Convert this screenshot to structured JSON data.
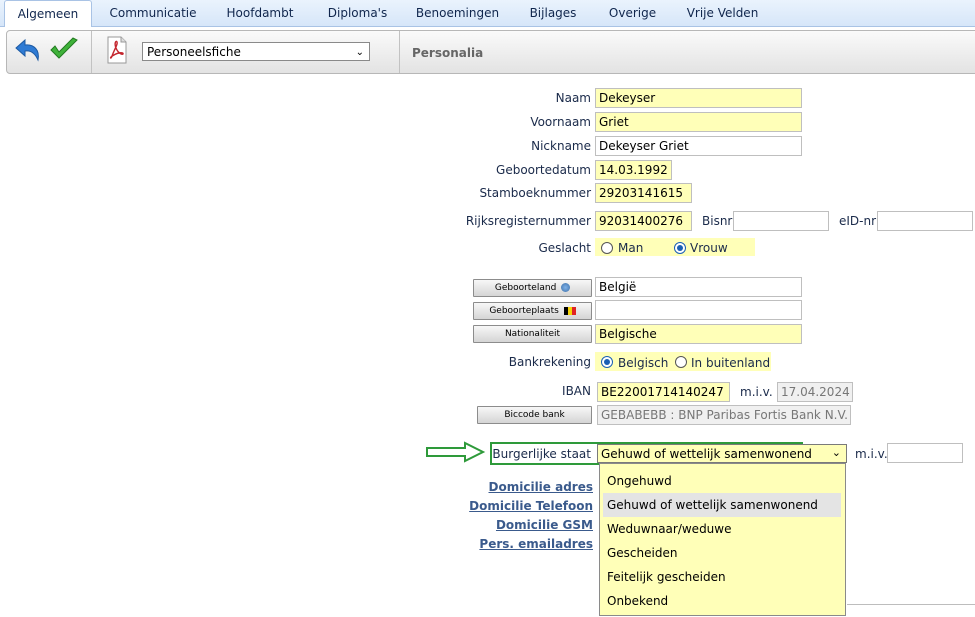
{
  "tabs": [
    "Algemeen",
    "Communicatie",
    "Hoofdambt",
    "Diploma's",
    "Benoemingen",
    "Bijlages",
    "Overige",
    "Vrije Velden"
  ],
  "toolbar": {
    "document_select": "Personeelsfiche",
    "section_title": "Personalia"
  },
  "form": {
    "naam": {
      "label": "Naam",
      "value": "Dekeyser"
    },
    "voornaam": {
      "label": "Voornaam",
      "value": "Griet"
    },
    "nickname": {
      "label": "Nickname",
      "value": "Dekeyser Griet"
    },
    "geboortedatum": {
      "label": "Geboortedatum",
      "value": "14.03.1992"
    },
    "stamboeknummer": {
      "label": "Stamboeknummer",
      "value": "29203141615"
    },
    "rijksregisternummer": {
      "label": "Rijksregisternummer",
      "value": "92031400276"
    },
    "bisnr": {
      "label": "Bisnr",
      "value": ""
    },
    "eid": {
      "label": "eID-nr",
      "value": ""
    },
    "geslacht": {
      "label": "Geslacht",
      "options": [
        "Man",
        "Vrouw"
      ],
      "selected": "Vrouw"
    },
    "geboorteland": {
      "button": "Geboorteland",
      "value": "België"
    },
    "geboorteplaats": {
      "button": "Geboorteplaats",
      "value": ""
    },
    "nationaliteit": {
      "button": "Nationaliteit",
      "value": "Belgische"
    },
    "bankrekening": {
      "label": "Bankrekening",
      "options": [
        "Belgisch",
        "In buitenland"
      ],
      "selected": "Belgisch"
    },
    "iban": {
      "label": "IBAN",
      "value": "BE22001714140247",
      "miv_label": "m.i.v.",
      "miv_value": "17.04.2024"
    },
    "biccode": {
      "button": "Biccode bank",
      "value": "GEBABEBB : BNP Paribas Fortis Bank N.V."
    },
    "burgerlijke_staat": {
      "label": "Burgerlijke staat",
      "value": "Gehuwd of wettelijk samenwonend",
      "miv_label": "m.i.v.",
      "miv_value": ""
    }
  },
  "links": [
    "Domicilie adres",
    "Domicilie Telefoon",
    "Domicilie GSM",
    "Pers. emailadres"
  ],
  "dropdown": {
    "options": [
      "Ongehuwd",
      "Gehuwd of wettelijk samenwonend",
      "Weduwnaar/weduwe",
      "Gescheiden",
      "Feitelijk gescheiden",
      "Onbekend"
    ],
    "highlighted": "Gehuwd of wettelijk samenwonend"
  },
  "colors": {
    "required_field": "#ffffb8",
    "highlight_box": "#2e9a3a",
    "tab_bar": "#d6e6f9"
  }
}
